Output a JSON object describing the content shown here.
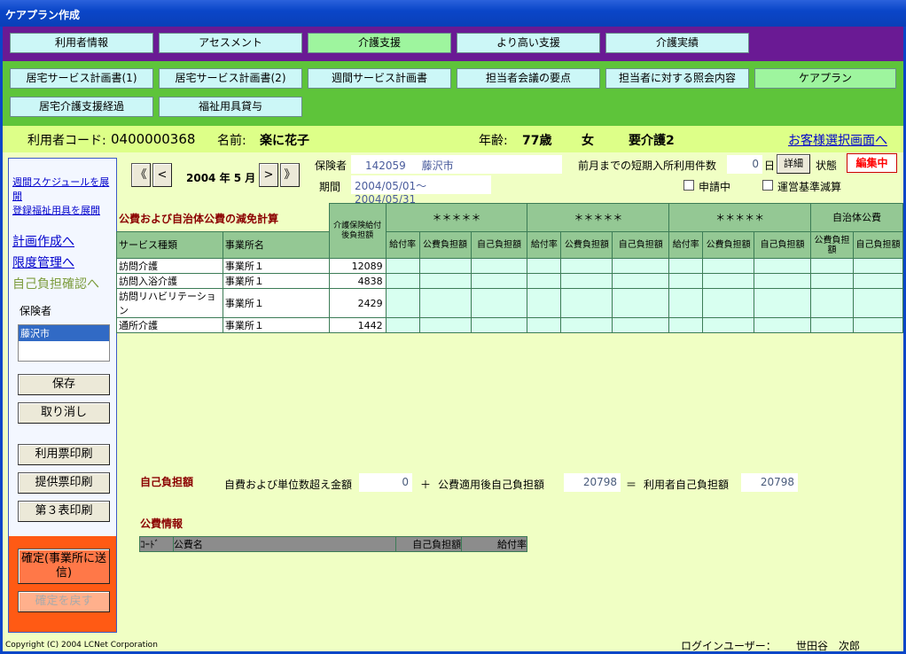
{
  "window": {
    "title": "ケアプラン作成"
  },
  "main_nav": [
    {
      "label": "利用者情報",
      "active": false
    },
    {
      "label": "アセスメント",
      "active": false
    },
    {
      "label": "介護支援",
      "active": true
    },
    {
      "label": "より高い支援",
      "active": false
    },
    {
      "label": "介護実績",
      "active": false
    }
  ],
  "sub_nav": [
    {
      "label": "居宅サービス計画書(1)",
      "active": false
    },
    {
      "label": "居宅サービス計画書(2)",
      "active": false
    },
    {
      "label": "週間サービス計画書",
      "active": false
    },
    {
      "label": "担当者会議の要点",
      "active": false
    },
    {
      "label": "担当者に対する照会内容",
      "active": false
    },
    {
      "label": "ケアプラン",
      "active": true
    },
    {
      "label": "居宅介護支援経過",
      "active": false
    },
    {
      "label": "福祉用具貸与",
      "active": false
    }
  ],
  "user": {
    "code_label": "利用者コード:",
    "code": "0400000368",
    "name_label": "名前:",
    "name": "楽に花子",
    "age_label": "年齢:",
    "age": "77歳",
    "sex": "女",
    "care_level": "要介護2",
    "customer_select_link": "お客様選択画面へ"
  },
  "sidebar": {
    "links_small": [
      "週間スケジュールを展開",
      "登録福祉用具を展開"
    ],
    "links_big": [
      "計画作成へ",
      "限度管理へ"
    ],
    "current": "自己負担確認へ",
    "insurer_label": "保険者",
    "insurer_list": [
      "藤沢市"
    ],
    "save": "保存",
    "cancel": "取り消し",
    "print_usage": "利用票印刷",
    "print_provide": "提供票印刷",
    "print_table3": "第３表印刷",
    "confirm": "確定(事業所に送信)",
    "unconfirm": "確定を戻す"
  },
  "period_nav": {
    "first": "《",
    "prev": "<",
    "month": "2004 年 5 月",
    "next": ">",
    "last": "》"
  },
  "info": {
    "insurer_label": "保険者",
    "insurer_code": "142059",
    "insurer_name": "藤沢市",
    "period_label": "期間",
    "period": "2004/05/01～2004/05/31",
    "short_stay_label": "前月までの短期入所利用件数",
    "short_stay_value": "0",
    "day_unit": "日",
    "detail_button": "詳細",
    "status_label": "状態",
    "status_value": "編集中",
    "applying_label": "申請中",
    "reduction_label": "運営基準減算"
  },
  "table": {
    "section_title": "公費および自治体公費の減免計算",
    "col_service": "サービス種類",
    "col_office": "事業所名",
    "col_benefit": "介護保険給付後負担額",
    "group_labels": [
      "＊＊＊＊＊",
      "＊＊＊＊＊",
      "＊＊＊＊＊"
    ],
    "group_last": "自治体公費",
    "sub_rate": "給付率",
    "sub_public": "公費負担額",
    "sub_self": "自己負担額",
    "rows": [
      {
        "service": "訪問介護",
        "office": "事業所１",
        "amount": "12089"
      },
      {
        "service": "訪問入浴介護",
        "office": "事業所１",
        "amount": "4838"
      },
      {
        "service": "訪問リハビリテーション",
        "office": "事業所１",
        "amount": "2429"
      },
      {
        "service": "通所介護",
        "office": "事業所１",
        "amount": "1442"
      }
    ]
  },
  "self_pay": {
    "title": "自己負担額",
    "excess_label": "自費および単位数超え金額",
    "excess_value": "0",
    "plus": "＋",
    "after_public_label": "公費適用後自己負担額",
    "after_public_value": "20798",
    "equals": "＝",
    "user_self_label": "利用者自己負担額",
    "user_self_value": "20798"
  },
  "public_info": {
    "title": "公費情報",
    "col_code": "ｺｰﾄﾞ",
    "col_name": "公費名",
    "col_self": "自己負担額",
    "col_rate": "給付率"
  },
  "footer": {
    "copyright": "Copyright (C) 2004 LCNet Corporation",
    "login_label": "ログインユーザー：",
    "login_user": "世田谷　次郎"
  },
  "colors": {
    "main_nav_bg": "#6a1a94",
    "sub_nav_bg": "#5ec43a",
    "content_bg": "#f0ffc4",
    "status_red": "#ff0000"
  }
}
